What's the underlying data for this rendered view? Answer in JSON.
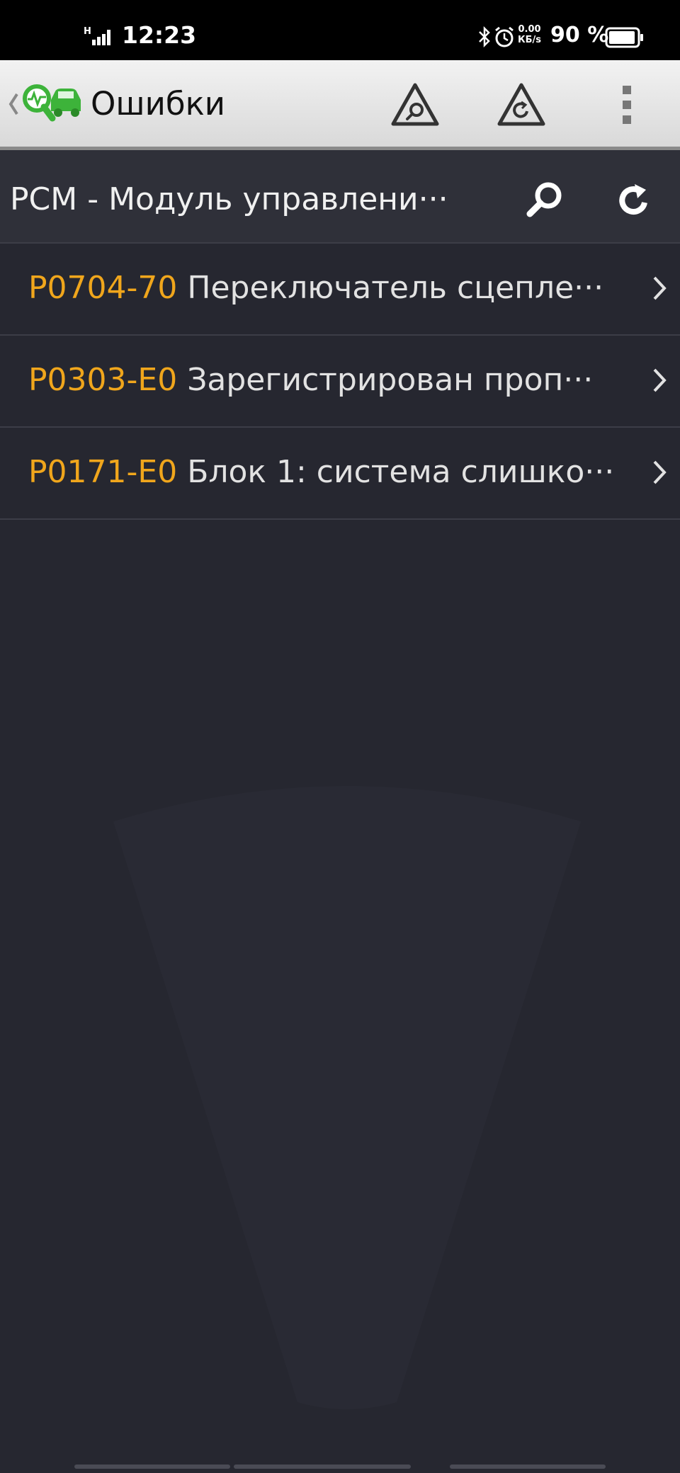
{
  "status_bar": {
    "network": "H",
    "time": "12:23",
    "speed_value": "0.00",
    "speed_unit": "КБ/s",
    "battery_pct": "90 %",
    "icons": [
      "signal-icon",
      "bluetooth-icon",
      "alarm-icon",
      "battery-icon"
    ]
  },
  "app_bar": {
    "title": "Ошибки",
    "icons": [
      "back-chevron-icon",
      "app-logo-icon",
      "scan-warning-icon",
      "refresh-warning-icon",
      "more-vert-icon"
    ],
    "logo_color": "#3db33a"
  },
  "module": {
    "title": "PCM - Модуль управлени···",
    "icons": [
      "search-icon",
      "refresh-icon"
    ]
  },
  "errors": [
    {
      "code": "P0704-70",
      "description": "Переключатель сцепле···"
    },
    {
      "code": "P0303-E0",
      "description": "Зарегистрирован проп···"
    },
    {
      "code": "P0171-E0",
      "description": "Блок 1: система слишко···"
    }
  ],
  "colors": {
    "background": "#262730",
    "code": "#f0a61c",
    "text": "#e2e2e2"
  }
}
